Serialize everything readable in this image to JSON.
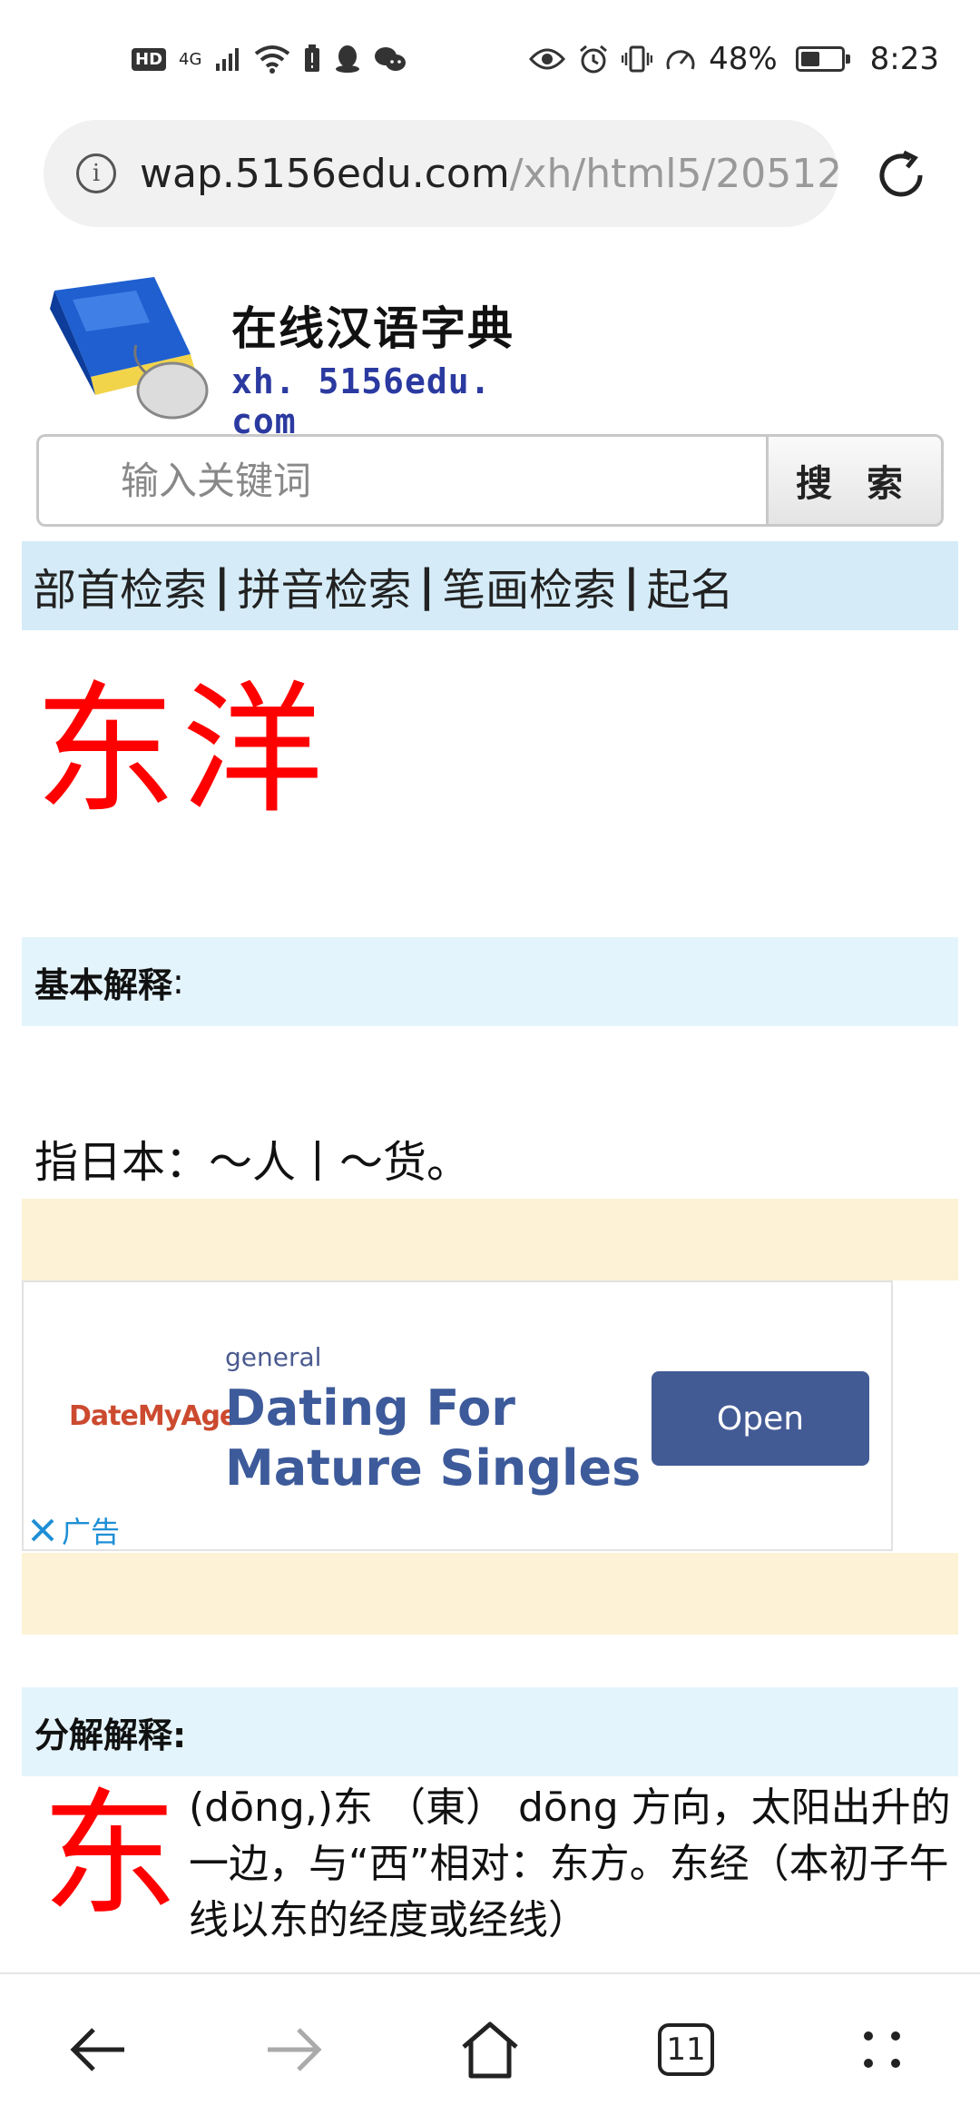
{
  "status_bar": {
    "hd": "HD",
    "network": "4G",
    "battery_percent": "48%",
    "battery_level": 0.48,
    "time": "8:23"
  },
  "browser": {
    "url_host": "wap.5156edu.com",
    "url_path": "/xh/html5/20512"
  },
  "site": {
    "title": "在线汉语字典",
    "subtitle": "xh. 5156edu. com"
  },
  "search": {
    "placeholder": "输入关键词",
    "button_label": "搜 索"
  },
  "nav": {
    "items": [
      "部首检索",
      "拼音检索",
      "笔画检索",
      "起名"
    ],
    "separator": "|"
  },
  "entry": {
    "word": "东洋",
    "basic_heading": "基本解释",
    "basic_colon": ":",
    "basic_definition": "指日本：～人丨～货。",
    "decomp_heading": "分解解释:",
    "decomp_char": "东",
    "decomp_text": "(dōng,)东 （東） dōng 方向，太阳出升的一边，与“西”相对：东方。东经（本初子午线以东的经度或经线）"
  },
  "ad": {
    "advertiser": "DateMyAge",
    "category": "general",
    "headline": "Dating For Mature Singles",
    "cta": "Open",
    "label": "广告"
  },
  "bottom_nav": {
    "tab_count": "11"
  }
}
